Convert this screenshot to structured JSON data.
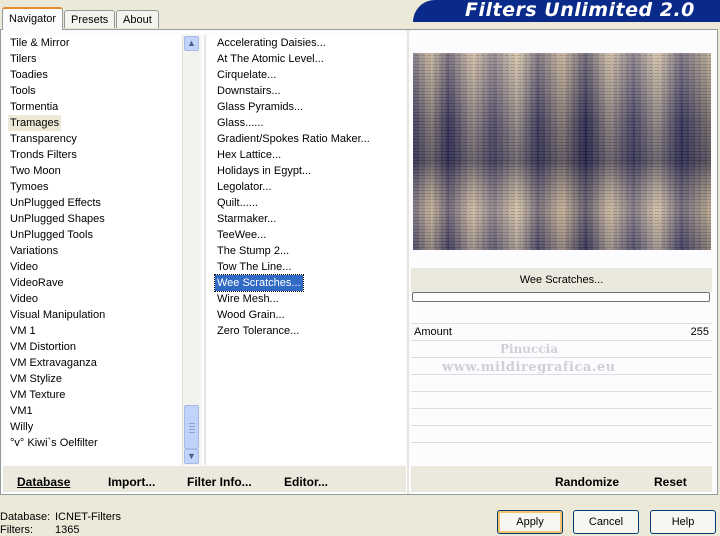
{
  "tabs": [
    "Navigator",
    "Presets",
    "About"
  ],
  "banner_title": "Filters Unlimited 2.0",
  "categories": [
    "Tile & Mirror",
    "Tilers",
    "Toadies",
    "Tools",
    "Tormentia",
    "Tramages",
    "Transparency",
    "Tronds Filters",
    "Two Moon",
    "Tymoes",
    "UnPlugged Effects",
    "UnPlugged Shapes",
    "UnPlugged Tools",
    "Variations",
    "Video",
    "VideoRave",
    "Video",
    "Visual Manipulation",
    "VM 1",
    "VM Distortion",
    "VM Extravaganza",
    "VM Stylize",
    "VM Texture",
    "VM1",
    "Willy",
    "°v° Kiwi`s Oelfilter"
  ],
  "selected_category": "Tramages",
  "filters": [
    "Accelerating Daisies...",
    "At The Atomic Level...",
    "Cirquelate...",
    "Downstairs...",
    "Glass Pyramids...",
    "Glass......",
    "Gradient/Spokes Ratio Maker...",
    "Hex Lattice...",
    "Holidays in Egypt...",
    "Legolator...",
    "Quilt......",
    "Starmaker...",
    "TeeWee...",
    "The Stump 2...",
    "Tow The Line...",
    "Wee Scratches...",
    "Wire Mesh...",
    "Wood Grain...",
    "Zero Tolerance..."
  ],
  "selected_filter": "Wee Scratches...",
  "current_filter_name": "Wee Scratches...",
  "parameter": {
    "label": "Amount",
    "value": "255"
  },
  "watermark": {
    "line1": "Pinuccia",
    "line2": "www.mildiregrafica.eu"
  },
  "left_buttons": {
    "database": "Database",
    "import": "Import...",
    "filter_info": "Filter Info...",
    "editor": "Editor..."
  },
  "right_buttons": {
    "randomize": "Randomize",
    "reset": "Reset"
  },
  "footer": {
    "db_label": "Database:",
    "db_value": "ICNET-Filters",
    "filters_label": "Filters:",
    "filters_value": "1365"
  },
  "dialog_buttons": {
    "apply": "Apply",
    "cancel": "Cancel",
    "help": "Help"
  },
  "colors": {
    "banner": "#0a2a8a",
    "selection": "#316ac5",
    "tab_accent": "#e68b2c"
  }
}
